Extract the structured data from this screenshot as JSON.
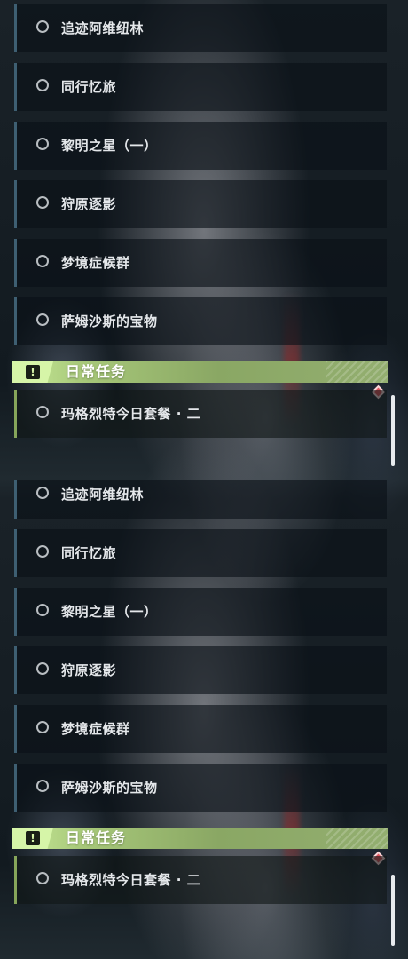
{
  "quest_list": {
    "items": [
      {
        "label": "追迹阿维纽林"
      },
      {
        "label": "同行忆旅"
      },
      {
        "label": "黎明之星（一）"
      },
      {
        "label": "狩原逐影"
      },
      {
        "label": "梦境症候群"
      },
      {
        "label": "萨姆沙斯的宝物"
      }
    ]
  },
  "daily": {
    "title": "日常任务",
    "badge_glyph": "!",
    "items": [
      {
        "label": "玛格烈特今日套餐 · 二"
      }
    ]
  },
  "icons": {
    "radio": "radio-circle-icon",
    "alert": "exclamation-box-icon",
    "marker": "red-diamond-marker-icon"
  },
  "colors": {
    "accent_daily": "#a8c97a",
    "badge": "#d6f5a8",
    "quest_border": "#3e5f72",
    "marker": "#e0555e"
  }
}
